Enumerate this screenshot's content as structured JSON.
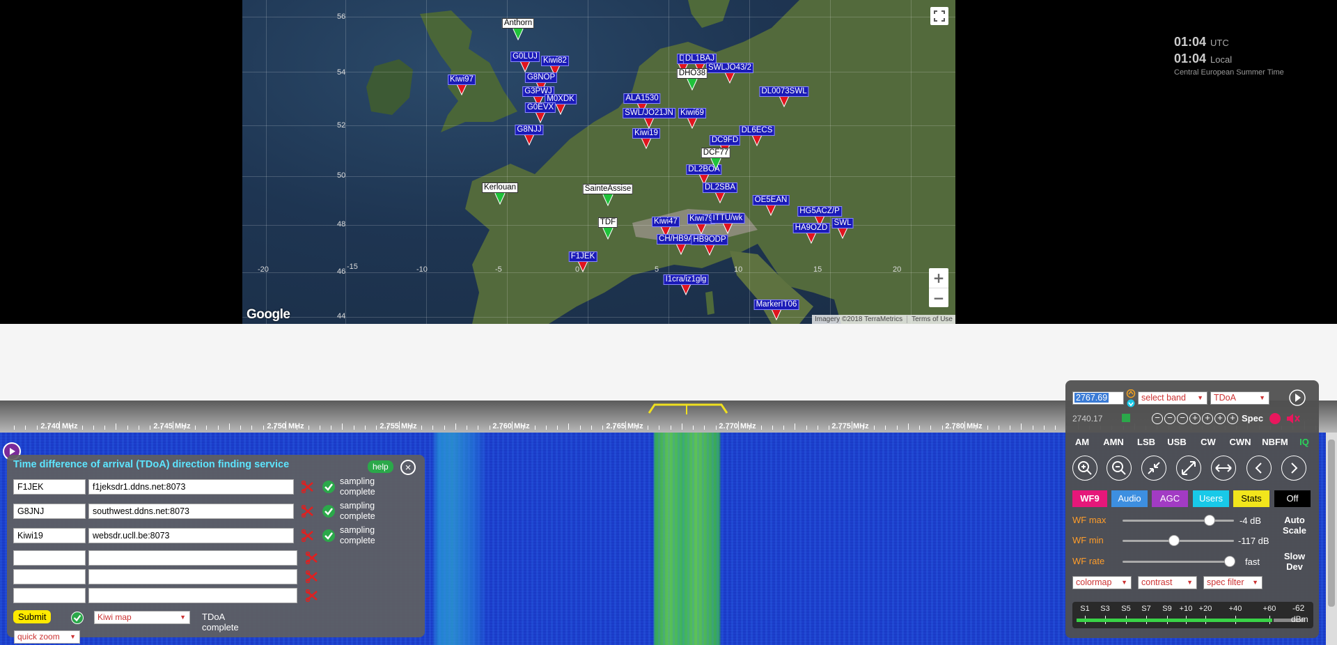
{
  "map": {
    "lat_labels": [
      "56",
      "54",
      "52",
      "50",
      "48",
      "46",
      "44"
    ],
    "lon_labels": [
      "-20",
      "-15",
      "-10",
      "-5",
      "0",
      "5",
      "10",
      "15",
      "20"
    ],
    "kiwi_markers": [
      "G0LUJ",
      "Kiwi82",
      "G8NOP",
      "G3PWJ",
      "M0XDK",
      "G0EVX",
      "G8NJJ",
      "Kiwi97",
      "DI",
      "DL1BAJ",
      "SWLJO43/2",
      "ALA1530",
      "SWL/JO21JN",
      "Kiwi69",
      "DL0073SWL",
      "Kiwi19",
      "DC9FD",
      "DL6ECS",
      "DL2BOA",
      "DL2SBA",
      "Kiwi47",
      "Kiwi79",
      "ITTU/wk",
      "OE5EAN",
      "HG5ACZ/P",
      "HA9OZD",
      "SWL",
      "CH/HB9ADJ",
      "HB9ODP",
      "F1JEK",
      "I1cra/iz1glg",
      "MarkerIT06"
    ],
    "ref_markers": [
      "Anthorn",
      "DHO38",
      "DCF77",
      "Kerlouan",
      "SainteAssise",
      "TDF"
    ],
    "google_label": "Google",
    "imagery_label": "Imagery ©2018 TerraMetrics",
    "terms_label": "Terms of Use",
    "zoom_in": "+",
    "zoom_out": "−"
  },
  "clock": {
    "utc_time": "01:04",
    "utc_label": "UTC",
    "local_time": "01:04",
    "local_label": "Local",
    "timezone": "Central European Summer Time"
  },
  "scale": {
    "labels": [
      "2.740 MHz",
      "2.745 MHz",
      "2.750 MHz",
      "2.755 MHz",
      "2.760 MHz",
      "2.765 MHz",
      "2.770 MHz",
      "2.775 MHz",
      "2.780 MHz"
    ]
  },
  "tdoa": {
    "title": "Time difference of arrival (TDoA) direction finding service",
    "help_label": "help",
    "close_label": "×",
    "hosts": [
      {
        "id": "F1JEK",
        "url": "f1jeksdr1.ddns.net:8073",
        "status": "sampling complete"
      },
      {
        "id": "G8JNJ",
        "url": "southwest.ddns.net:8073",
        "status": "sampling complete"
      },
      {
        "id": "Kiwi19",
        "url": "websdr.ucll.be:8073",
        "status": "sampling complete"
      }
    ],
    "submit_label": "Submit",
    "map_select": "Kiwi map",
    "result_status": "TDoA complete",
    "quick_zoom": "quick zoom"
  },
  "control": {
    "frequency": "2767.69",
    "band_select": "select band",
    "ext_select": "TDoA",
    "freq_readout": "2740.17",
    "spec_label": "Spec",
    "modes": [
      "AM",
      "AMN",
      "LSB",
      "USB",
      "CW",
      "CWN",
      "NBFM",
      "IQ"
    ],
    "tabs": [
      {
        "label": "WF9",
        "color": "#e6177a"
      },
      {
        "label": "Audio",
        "color": "#3d8fe0"
      },
      {
        "label": "AGC",
        "color": "#a23bc4"
      },
      {
        "label": "Users",
        "color": "#18c9e8"
      },
      {
        "label": "Stats",
        "color": "#f2e51c"
      },
      {
        "label": "Off",
        "color": "#000000"
      }
    ],
    "wf_max": {
      "label": "WF max",
      "value": "-4 dB",
      "level": 0.78
    },
    "wf_min": {
      "label": "WF min",
      "value": "-117 dB",
      "level": 0.46
    },
    "wf_rate": {
      "label": "WF rate",
      "value": "fast",
      "level": 0.96
    },
    "auto_scale": "Auto Scale",
    "slow_dev": "Slow Dev",
    "colormap": "colormap",
    "contrast": "contrast",
    "spec_filter": "spec filter",
    "smeter_labels": [
      "S1",
      "S3",
      "S5",
      "S7",
      "S9",
      "+10",
      "+20",
      "+40",
      "+60"
    ],
    "smeter_value": "-62",
    "smeter_unit": "dBm",
    "smeter_level": 0.86
  }
}
